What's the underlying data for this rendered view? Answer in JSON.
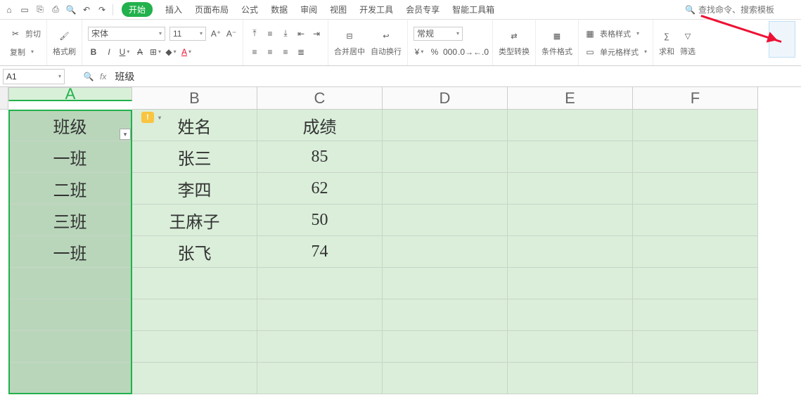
{
  "menubar": {
    "tabs": [
      "开始",
      "插入",
      "页面布局",
      "公式",
      "数据",
      "审阅",
      "视图",
      "开发工具",
      "会员专享",
      "智能工具箱"
    ],
    "active_tab": "开始",
    "search_placeholder": "查找命令、搜索模板"
  },
  "ribbon": {
    "clipboard": {
      "cut": "剪切",
      "copy": "复制",
      "painter": "格式刷"
    },
    "font": {
      "name": "宋体",
      "size": "11"
    },
    "merge": "合并居中",
    "wrap": "自动换行",
    "number_format": "常规",
    "typeconv": "类型转换",
    "condfmt": "条件格式",
    "tablestyle": "表格样式",
    "cellstyle": "单元格样式",
    "sum": "求和",
    "filter": "筛选"
  },
  "formula_bar": {
    "namebox": "A1",
    "fx": "fx",
    "value": "班级"
  },
  "columns": [
    "A",
    "B",
    "C",
    "D",
    "E",
    "F"
  ],
  "data": {
    "rows": [
      {
        "A": "班级",
        "B": "姓名",
        "C": "成绩"
      },
      {
        "A": "一班",
        "B": "张三",
        "C": "85"
      },
      {
        "A": "二班",
        "B": "李四",
        "C": "62"
      },
      {
        "A": "三班",
        "B": "王麻子",
        "C": "50"
      },
      {
        "A": "一班",
        "B": "张飞",
        "C": "74"
      },
      {
        "A": "",
        "B": "",
        "C": ""
      },
      {
        "A": "",
        "B": "",
        "C": ""
      },
      {
        "A": "",
        "B": "",
        "C": ""
      },
      {
        "A": "",
        "B": "",
        "C": ""
      }
    ]
  }
}
